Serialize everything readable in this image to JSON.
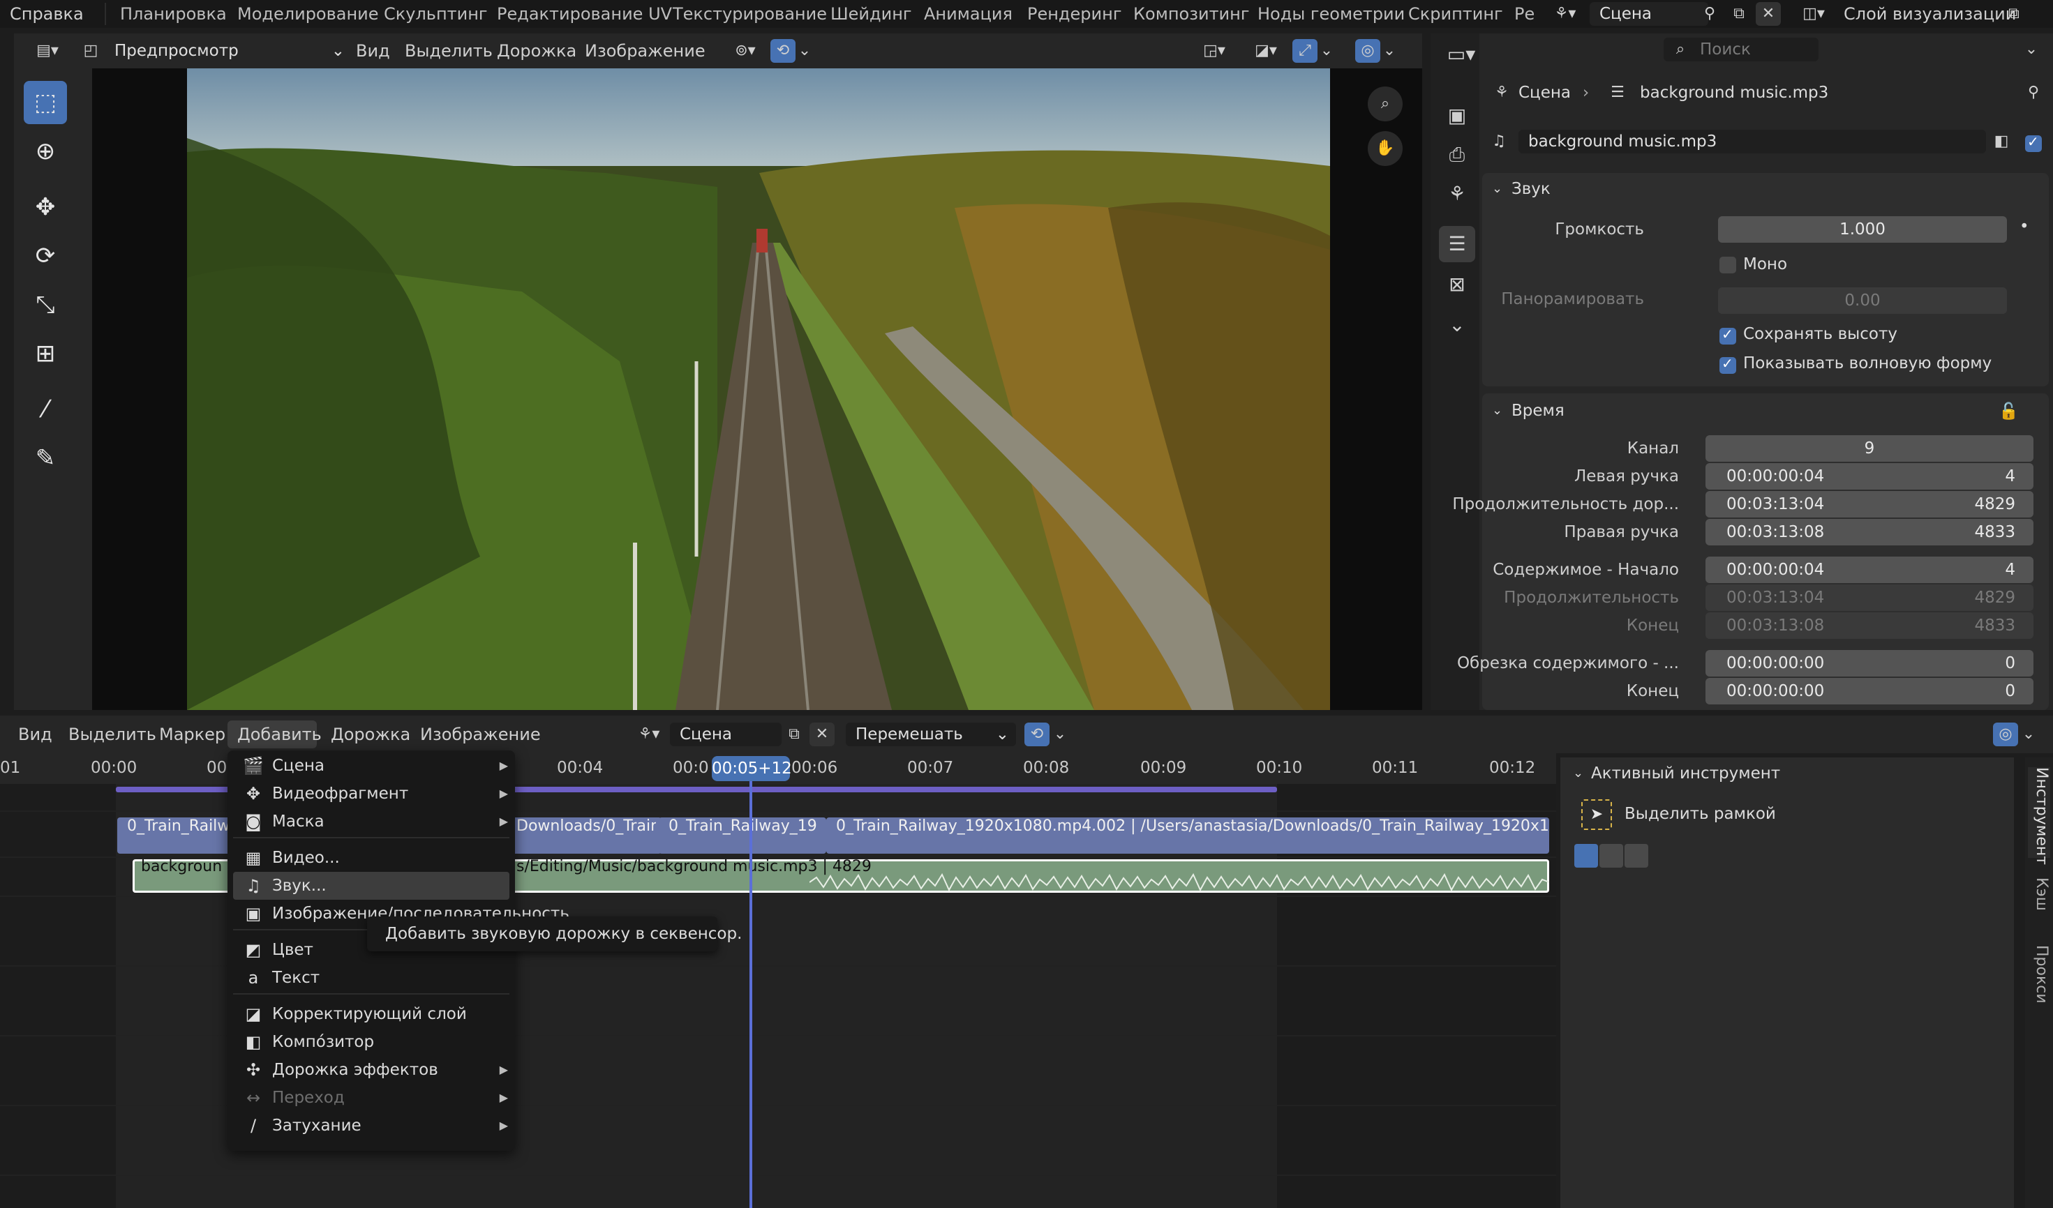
{
  "topbar": {
    "menu_help": "Справка",
    "workspaces": [
      "Планировка",
      "Моделирование",
      "Скульптинг",
      "Редактирование UV",
      "Текстурирование",
      "Шейдинг",
      "Анимация",
      "Рендеринг",
      "Композитинг",
      "Ноды геометрии",
      "Скриптинг",
      "Ре"
    ],
    "scene_value": "Сцена",
    "view_layer_label": "Слой визуализации"
  },
  "preview": {
    "mode_value": "Предпросмотр",
    "menus": [
      "Вид",
      "Выделить",
      "Дорожка",
      "Изображение"
    ]
  },
  "props": {
    "search_placeholder": "Поиск",
    "breadcrumb_scene": "Сцена",
    "breadcrumb_strip": "background music.mp3",
    "strip_name": "background music.mp3",
    "sound_panel": {
      "title": "Звук",
      "volume_label": "Громкость",
      "volume_value": "1.000",
      "mono_label": "Моно",
      "pan_label": "Панорамировать",
      "pan_value": "0.00",
      "keep_pitch_label": "Сохранять высоту",
      "show_waveform_label": "Показывать волновую форму"
    },
    "time_panel": {
      "title": "Время",
      "rows": [
        {
          "label": "Канал",
          "time": "",
          "frames": "9",
          "dim": false
        },
        {
          "label": "Левая ручка",
          "time": "00:00:00:04",
          "frames": "4",
          "dim": false
        },
        {
          "label": "Продолжительность дор...",
          "time": "00:03:13:04",
          "frames": "4829",
          "dim": false
        },
        {
          "label": "Правая ручка",
          "time": "00:03:13:08",
          "frames": "4833",
          "dim": false
        },
        {
          "label": "Содержимое - Начало",
          "time": "00:00:00:04",
          "frames": "4",
          "dim": false
        },
        {
          "label": "Продолжительность",
          "time": "00:03:13:04",
          "frames": "4829",
          "dim": true
        },
        {
          "label": "Конец",
          "time": "00:03:13:08",
          "frames": "4833",
          "dim": true
        },
        {
          "label": "Обрезка содержимого - ...",
          "time": "00:00:00:00",
          "frames": "0",
          "dim": false
        },
        {
          "label": "Конец",
          "time": "00:00:00:00",
          "frames": "0",
          "dim": false
        }
      ]
    }
  },
  "sequencer": {
    "menus": [
      "Вид",
      "Выделить",
      "Маркер",
      "Добавить",
      "Дорожка",
      "Изображение"
    ],
    "scene_value": "Сцена",
    "blend_value": "Перемешать",
    "current_time": "00:05+12",
    "ruler": [
      "01",
      "00:00",
      "00",
      "00:04",
      "00:0",
      "00:06",
      "00:07",
      "00:08",
      "00:09",
      "00:10",
      "00:11",
      "00:12"
    ],
    "strips": {
      "video1": "0_Train_Railw",
      "video2": "Downloads/0_Train",
      "video3": "0_Train_Railway_19",
      "video4": "0_Train_Railway_1920x1080.mp4.002 | /Users/anastasia/Downloads/0_Train_Railway_1920x1080.",
      "audio1": "backgroun",
      "audio2": "s/Editing/Music/background music.mp3 | 4829"
    }
  },
  "add_menu": {
    "items": [
      {
        "icon": "🎬",
        "label": "Сцена",
        "submenu": true
      },
      {
        "icon": "✥",
        "label": "Видеофрагмент",
        "submenu": true
      },
      {
        "icon": "◙",
        "label": "Маска",
        "submenu": true
      },
      {
        "icon": "▦",
        "label": "Видео...",
        "submenu": false
      },
      {
        "icon": "♫",
        "label": "Звук...",
        "submenu": false
      },
      {
        "icon": "▣",
        "label": "Изображение/последовательность",
        "submenu": false
      },
      {
        "icon": "◩",
        "label": "Цвет",
        "submenu": false
      },
      {
        "icon": "a",
        "label": "Текст",
        "submenu": false
      },
      {
        "icon": "◪",
        "label": "Корректирующий слой",
        "submenu": false
      },
      {
        "icon": "◧",
        "label": "Компо́зитор",
        "submenu": false
      },
      {
        "icon": "✣",
        "label": "Дорожка эффектов",
        "submenu": true
      },
      {
        "icon": "↔",
        "label": "Переход",
        "submenu": true
      },
      {
        "icon": "∕",
        "label": "Затухание",
        "submenu": true
      }
    ],
    "tooltip": "Добавить звуковую дорожку в секвенсор."
  },
  "sidebar": {
    "active_tool_title": "Активный инструмент",
    "tool_name": "Выделить рамкой",
    "tabs": [
      "Инструмент",
      "Кэш",
      "Прокси"
    ]
  }
}
